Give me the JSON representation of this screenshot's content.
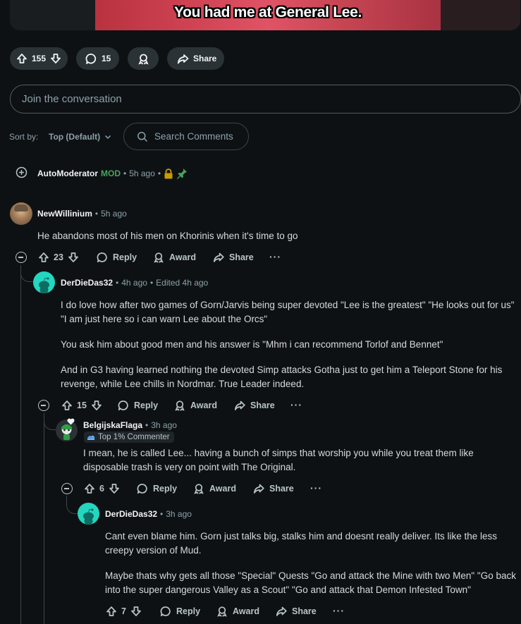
{
  "post": {
    "media_caption": "You had me at General Lee.",
    "vote_count": "155",
    "comment_count": "15",
    "share_label": "Share"
  },
  "composer": {
    "placeholder": "Join the conversation"
  },
  "sort": {
    "label": "Sort by:",
    "value": "Top (Default)"
  },
  "search": {
    "placeholder": "Search Comments"
  },
  "automod": {
    "username": "AutoModerator",
    "badge": "MOD",
    "time": "5h ago"
  },
  "comments": [
    {
      "username": "NewWillinium",
      "time": "5h ago",
      "edited": "",
      "body": [
        "He abandons most of his men on Khorinis when it's time to go"
      ],
      "votes": "23"
    },
    {
      "username": "DerDieDas32",
      "time": "4h ago",
      "edited": "Edited 4h ago",
      "body": [
        "I do love how after two games of Gorn/Jarvis being super devoted \"Lee is the greatest\" \"He looks out for us\" \"I am just here so i can warn Lee about the Orcs\"",
        "You ask him about good men and his answer is \"Mhm i can recommend Torlof and Bennet\"",
        "And in G3 having learned nothing the devoted Simp attacks Gotha just to get him a Teleport Stone for his revenge, while Lee chills in Nordmar. True Leader indeed."
      ],
      "votes": "15"
    },
    {
      "username": "BelgijskaFlaga",
      "time": "3h ago",
      "edited": "",
      "flair": "Top 1% Commenter",
      "body": [
        "I mean, he is called Lee... having a bunch of simps that worship you while you treat them like disposable trash is very on point with The Original."
      ],
      "votes": "6"
    },
    {
      "username": "DerDieDas32",
      "time": "3h ago",
      "edited": "",
      "body": [
        "Cant even blame him. Gorn just talks big, stalks him and doesnt really deliver. Its like the less creepy version of Mud.",
        "Maybe thats why gets all those \"Special\" Quests \"Go and attack the Mine with two Men\" \"Go back into the super dangerous Valley as a Scout\" \"Go and attack that Demon Infested Town\""
      ],
      "votes": "7"
    }
  ],
  "actions": {
    "reply": "Reply",
    "award": "Award",
    "share": "Share",
    "more": "···",
    "separator": "•"
  },
  "colors": {
    "background": "#0e1113",
    "pill": "#2a3236",
    "mod_green": "#46a55b",
    "snoo_teal": "#24d6c0",
    "lock_gold": "#c89b00"
  }
}
